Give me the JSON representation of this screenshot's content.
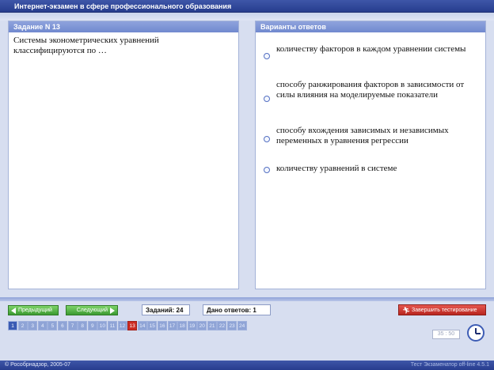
{
  "app_title": "Интернет-экзамен в сфере профессионального образования",
  "task_panel": {
    "header": "Задание N 13",
    "question": "Системы эконометрических уравнений классифицируются по …"
  },
  "answers_panel": {
    "header": "Варианты ответов",
    "options": [
      "количеству факторов в каждом уравнении системы",
      "способу ранжирования факторов в зависимости от силы влияния на моделируемые показатели",
      "способу вхождения зависимых и независимых переменных в уравнения регрессии",
      "количеству уравнений в системе"
    ]
  },
  "nav": {
    "prev_label": "Предыдущий",
    "next_label": "Следующий",
    "tasks_label": "Заданий: 24",
    "answered_label": "Дано ответов: 1",
    "finish_label": "Завершить тестирование"
  },
  "pages": [
    "1",
    "2",
    "3",
    "4",
    "5",
    "6",
    "7",
    "8",
    "9",
    "10",
    "11",
    "12",
    "13",
    "14",
    "15",
    "16",
    "17",
    "18",
    "19",
    "20",
    "21",
    "22",
    "23",
    "24"
  ],
  "current_page": "13",
  "timer": "35 : 50",
  "footer": {
    "left": "© Рособрнадзор, 2005-07",
    "right": "Тест Экзаменатор off-line 4.5.1"
  },
  "colors": {
    "title_bar": "#2f4596",
    "panel_header": "#7c93d6",
    "nav_button": "#4caf3c",
    "finish_button": "#c9302a",
    "current_page": "#cc2a22"
  }
}
